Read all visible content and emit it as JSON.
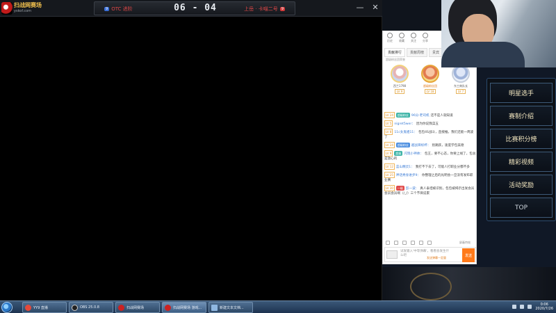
{
  "game_window": {
    "logo_cn": "扫战网赛场",
    "logo_url": "yskof.com",
    "team_left_tag": "9",
    "team_left_name": "OTC 进阶",
    "score": "06 - 04",
    "team_right_name": "上岳 · 卡喵二号",
    "team_right_tag": "9",
    "minimize_icon": "—",
    "close_icon": "✕"
  },
  "chat_panel": {
    "icons": [
      "历史",
      "收藏",
      "关注",
      "分享"
    ],
    "tabs": [
      "贡献排行",
      "贡献周榜",
      "贵宾"
    ],
    "rank_label": "超级粉丝团荣誉",
    "top_fans": [
      {
        "name": "西兰1798",
        "level": "LV 9"
      },
      {
        "name": "超级粉丝团",
        "level": "LV 18"
      },
      {
        "name": "东工商队长",
        "level": "LV 7"
      }
    ],
    "messages": [
      {
        "lv": "LV 24",
        "badge": "超级粉丝",
        "nick": "96分·老司机",
        "text": "还不是人就知道"
      },
      {
        "lv": "LV 5",
        "badge": "",
        "nick": "nigret5wer：",
        "text": "因为你说我菜五"
      },
      {
        "lv": "LV 8",
        "badge": "",
        "nick": "11c女鬼姐11：",
        "text": "包包4S战斗，直接推，我们还能一两波了"
      },
      {
        "lv": "LV 24",
        "badge": "超级粉丝",
        "nick": "越战目标杯：",
        "text": "别跳跃，速度学包美德"
      },
      {
        "lv": "LV 9",
        "badge": "超级",
        "nick": "闪现小神帅：",
        "text": "包王，要不心态，你要上线了，包总是放心的"
      },
      {
        "lv": "LV 12",
        "badge": "",
        "nick": "蓝山精灵1：",
        "text": "我打不下去了，可能人打职业分都不多"
      },
      {
        "lv": "LV 25",
        "badge": "",
        "nick": "神话秀身进步9：",
        "text": "你整理之后的光明会一旦没有发布职业赛"
      },
      {
        "lv": "LV 30",
        "badge": "一级",
        "nick": "彭一波：",
        "text": "真人泰坦被识别，包包被揭示出发会员会员会员啊（/_/）三个节目说累"
      }
    ],
    "toolbar_lock": "屏蔽特效",
    "input_placeholder": "试发输入'中等弹幕'，看看会发生什么吧",
    "input_tip": "发送弹幕一定量",
    "send_label": "发送"
  },
  "menu": {
    "items": [
      "明星选手",
      "赛制介绍",
      "比赛积分榜",
      "精彩视频",
      "活动奖励",
      "TOP"
    ]
  },
  "taskbar": {
    "tasks": [
      "YY9 直播",
      "OBS 25.0.8",
      "扫战网赛场",
      "扫战网赛场 游戏...",
      "新建文本文档..."
    ],
    "clock_time": "0:06",
    "clock_date": "2020/7/26"
  }
}
